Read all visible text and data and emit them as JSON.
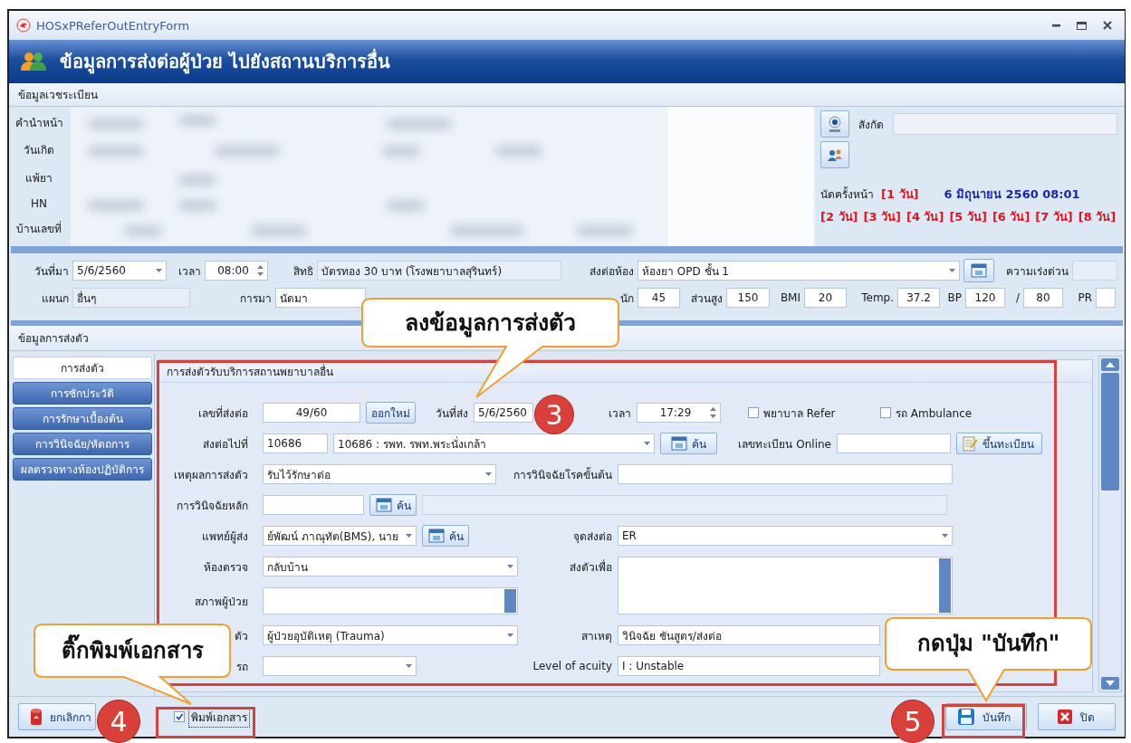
{
  "window": {
    "title": "HOSxPReferOutEntryForm"
  },
  "header": {
    "title": "ข้อมูลการส่งต่อผู้ป่วย ไปยังสถานบริการอื่น"
  },
  "patient": {
    "section_title": "ข้อมูลเวชระเบียน",
    "labels": [
      "คำนำหน้า",
      "วันเกิด",
      "แพ้ยา",
      "HN",
      "บ้านเลขที่"
    ],
    "affiliation_label": "สังกัด",
    "appointment": {
      "label": "นัดครั้งหน้า",
      "date": "6 มิถุนายน 2560 08:01",
      "days": [
        "[1 วัน]",
        "[2 วัน]",
        "[3 วัน]",
        "[4 วัน]",
        "[5 วัน]",
        "[6 วัน]",
        "[7 วัน]",
        "[8 วัน]"
      ]
    }
  },
  "visit": {
    "rows": [
      {
        "items": [
          {
            "kind": "label",
            "text": "วันที่มา"
          },
          {
            "kind": "dropdown",
            "value": "5/6/2560"
          },
          {
            "kind": "label",
            "text": "เวลา"
          },
          {
            "kind": "spin",
            "value": "08:00"
          },
          {
            "kind": "label",
            "text": "สิทธิ"
          },
          {
            "kind": "text",
            "value": "บัตรทอง 30 บาท (โรงพยาบาลสุรินทร์)",
            "disabled": true
          },
          {
            "kind": "label",
            "text": "ส่งต่อห้อง"
          },
          {
            "kind": "dropdown",
            "value": "ห้องยา OPD ชั้น 1"
          },
          {
            "kind": "icon_button"
          },
          {
            "kind": "label",
            "text": "ความเร่งด่วน"
          },
          {
            "kind": "text",
            "disabled": true
          }
        ]
      },
      {
        "items": [
          {
            "kind": "label",
            "text": "แผนก"
          },
          {
            "kind": "text",
            "value": "อื่นๆ",
            "disabled": true
          },
          {
            "kind": "label",
            "text": "การมา"
          },
          {
            "kind": "text",
            "value": "นัดมา",
            "disabled": false
          },
          {
            "kind": "label",
            "text": "นัก"
          },
          {
            "kind": "text",
            "value": "45",
            "disabled": false
          },
          {
            "kind": "label",
            "text": "ส่วนสูง"
          },
          {
            "kind": "text",
            "value": "150",
            "disabled": false
          },
          {
            "kind": "label",
            "text": "BMI"
          },
          {
            "kind": "text",
            "value": "20",
            "disabled": false
          },
          {
            "kind": "label",
            "text": "Temp."
          },
          {
            "kind": "text",
            "value": "37.2",
            "disabled": false
          },
          {
            "kind": "label",
            "text": "BP"
          },
          {
            "kind": "text",
            "value": "120",
            "disabled": false
          },
          {
            "kind": "label",
            "text": "/"
          },
          {
            "kind": "text",
            "value": "80",
            "disabled": false
          },
          {
            "kind": "label",
            "text": "PR"
          },
          {
            "kind": "text",
            "disabled": false
          }
        ]
      }
    ]
  },
  "referral": {
    "section_title": "ข้อมูลการส่งตัว",
    "tabs": [
      {
        "label": "การส่งตัว",
        "selected": true
      },
      {
        "label": "การซักประวัติ",
        "selected": false
      },
      {
        "label": "การรักษาเบื้องต้น",
        "selected": false
      },
      {
        "label": "การวินิจฉัย/หัตถการ",
        "selected": false
      },
      {
        "label": "ผลตรวจทางห้องปฏิบัติการ",
        "selected": false
      }
    ],
    "group_title": "การส่งตัวรับบริการสถานพยาบาลอื่น",
    "rows": [
      {
        "label": "เลขที่ส่งต่อ",
        "items": [
          {
            "kind": "text",
            "value": "49/60",
            "disabled": false
          },
          {
            "kind": "button",
            "text": "ออกใหม่"
          },
          {
            "kind": "label",
            "text": "วันที่ส่ง"
          },
          {
            "kind": "text",
            "value": "5/6/2560",
            "disabled": false
          },
          {
            "kind": "label",
            "text": "เวลา"
          },
          {
            "kind": "spin",
            "value": "17:29"
          },
          {
            "kind": "checkbox",
            "text": "พยาบาล Refer",
            "checked": false
          },
          {
            "kind": "checkbox",
            "text": "รถ Ambulance",
            "checked": false
          }
        ]
      },
      {
        "label": "ส่งต่อไปที่",
        "items": [
          {
            "kind": "text",
            "value": "10686",
            "disabled": false
          },
          {
            "kind": "dropdown",
            "value": "10686 : รพท. รพท.พระนั่งเกล้า"
          },
          {
            "kind": "search_button",
            "text": "ค้น"
          },
          {
            "kind": "label",
            "text": "เลขทะเบียน Online"
          },
          {
            "kind": "text",
            "disabled": false
          },
          {
            "kind": "register_button",
            "text": "ขึ้นทะเบียน"
          }
        ]
      },
      {
        "label": "เหตุผลการส่งตัว",
        "items": [
          {
            "kind": "dropdown",
            "value": "รับไว้รักษาต่อ"
          },
          {
            "kind": "label",
            "text": "การวินิจฉัยโรคขั้นต้น"
          },
          {
            "kind": "text",
            "disabled": false
          }
        ]
      },
      {
        "label": "การวินิจฉัยหลัก",
        "items": [
          {
            "kind": "text",
            "disabled": false
          },
          {
            "kind": "search_button",
            "text": "ค้น"
          },
          {
            "kind": "text",
            "disabled": true
          }
        ]
      },
      {
        "label": "แพทย์ผู้ส่ง",
        "items": [
          {
            "kind": "dropdown",
            "value": "ย์พัฒน์ ภาณุทัต(BMS), นาย"
          },
          {
            "kind": "search_button",
            "text": "ค้น"
          },
          {
            "kind": "label",
            "text": "จุดส่งต่อ"
          },
          {
            "kind": "dropdown",
            "value": "ER"
          }
        ]
      },
      {
        "label": "ห้องตรวจ",
        "items": [
          {
            "kind": "dropdown",
            "value": "กลับบ้าน"
          },
          {
            "kind": "label",
            "text": "ส่งตัวเพื่อ"
          },
          {
            "kind": "textarea"
          }
        ]
      },
      {
        "label": "สภาพผู้ป่วย",
        "items": [
          {
            "kind": "textarea"
          }
        ]
      },
      {
        "label": "ตัว",
        "items": [
          {
            "kind": "dropdown",
            "value": "ผู้ป่วยอุบัติเหตุ (Trauma)"
          },
          {
            "kind": "label",
            "text": "สาเหตุ"
          },
          {
            "kind": "text",
            "value": "วินิจฉัย ชันสูตร/ส่งต่อ",
            "disabled": false
          }
        ]
      },
      {
        "label": "รถ",
        "items": [
          {
            "kind": "dropdown"
          },
          {
            "kind": "label",
            "text": "Level of acuity"
          },
          {
            "kind": "text",
            "value": "I : Unstable",
            "disabled": false
          }
        ]
      }
    ]
  },
  "footer": {
    "cancel_button": "ยกเลิกกา",
    "print_checkbox": {
      "label": "พิมพ์เอกสาร",
      "checked": true
    },
    "save_button": "บันทึก",
    "close_button": "ปิด"
  },
  "annotations": {
    "callouts": [
      "ลงข้อมูลการส่งตัว",
      "ติ๊กพิมพ์เอกสาร",
      "กดปุ่ม \"บันทึก\""
    ],
    "step_markers": [
      "3",
      "4",
      "5"
    ]
  }
}
